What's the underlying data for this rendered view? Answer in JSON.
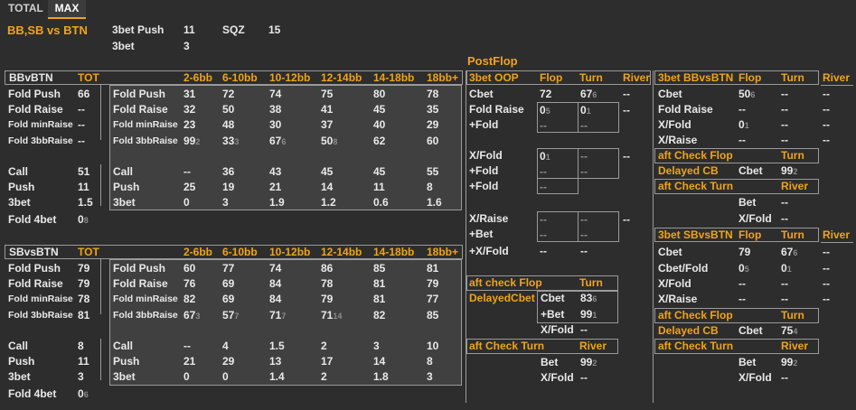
{
  "tabs": {
    "total": "TOTAL",
    "max": "MAX"
  },
  "header": {
    "title": "BB,SB vs BTN",
    "bet3push_label": "3bet Push",
    "bet3push_value": "11",
    "sqz_label": "SQZ",
    "sqz_value": "15",
    "bet3_label": "3bet",
    "bet3_value": "3"
  },
  "postflop_title": "PostFlop",
  "bb": {
    "title": "BBvBTN",
    "tot": "TOT",
    "cols": [
      "2-6bb",
      "6-10bb",
      "10-12bb",
      "12-14bb",
      "14-18bb",
      "18bb+"
    ],
    "rows": [
      {
        "label": "Fold Push",
        "tot": "66",
        "vals": [
          "31",
          "72",
          "74",
          "75",
          "80",
          "78"
        ],
        "sup": [
          "",
          "",
          "",
          "",
          "",
          ""
        ]
      },
      {
        "label": "Fold Raise",
        "tot": "--",
        "vals": [
          "32",
          "50",
          "38",
          "41",
          "45",
          "35"
        ],
        "sup": [
          "",
          "",
          "",
          "",
          "",
          ""
        ]
      },
      {
        "label": "Fold minRaise",
        "tot": "--",
        "vals": [
          "23",
          "48",
          "30",
          "37",
          "40",
          "29"
        ],
        "sup": [
          "",
          "",
          "",
          "",
          "",
          ""
        ]
      },
      {
        "label": "Fold 3bbRaise",
        "tot": "--",
        "vals": [
          "99",
          "33",
          "67",
          "50",
          "62",
          "60"
        ],
        "sup": [
          "2",
          "3",
          "6",
          "8",
          "",
          ""
        ]
      },
      {
        "label": "Call",
        "tot": "51",
        "vals": [
          "--",
          "36",
          "43",
          "45",
          "45",
          "55"
        ],
        "sup": [
          "",
          "",
          "",
          "",
          "",
          ""
        ]
      },
      {
        "label": "Push",
        "tot": "11",
        "vals": [
          "25",
          "19",
          "21",
          "14",
          "11",
          "8"
        ],
        "sup": [
          "",
          "",
          "",
          "",
          "",
          ""
        ]
      },
      {
        "label": "3bet",
        "tot": "1.5",
        "vals": [
          "0",
          "3",
          "1.9",
          "1.2",
          "0.6",
          "1.6"
        ],
        "sup": [
          "",
          "",
          "",
          "",
          "",
          ""
        ]
      }
    ],
    "fold4bet_label": "Fold 4bet",
    "fold4bet_value": "0",
    "fold4bet_sup": "8"
  },
  "sb": {
    "title": "SBvsBTN",
    "tot": "TOT",
    "cols": [
      "2-6bb",
      "6-10bb",
      "10-12bb",
      "12-14bb",
      "14-18bb",
      "18bb+"
    ],
    "rows": [
      {
        "label": "Fold Push",
        "tot": "79",
        "vals": [
          "60",
          "77",
          "74",
          "86",
          "85",
          "81"
        ],
        "sup": [
          "",
          "",
          "",
          "",
          "",
          ""
        ]
      },
      {
        "label": "Fold Raise",
        "tot": "79",
        "vals": [
          "76",
          "69",
          "84",
          "78",
          "81",
          "79"
        ],
        "sup": [
          "",
          "",
          "",
          "",
          "",
          ""
        ]
      },
      {
        "label": "Fold minRaise",
        "tot": "78",
        "vals": [
          "82",
          "69",
          "84",
          "79",
          "81",
          "77"
        ],
        "sup": [
          "",
          "",
          "",
          "",
          "",
          ""
        ]
      },
      {
        "label": "Fold 3bbRaise",
        "tot": "81",
        "vals": [
          "67",
          "57",
          "71",
          "71",
          "82",
          "85"
        ],
        "sup": [
          "3",
          "7",
          "7",
          "14",
          "",
          ""
        ]
      },
      {
        "label": "Call",
        "tot": "8",
        "vals": [
          "--",
          "4",
          "1.5",
          "2",
          "3",
          "10"
        ],
        "sup": [
          "",
          "",
          "",
          "",
          "",
          ""
        ]
      },
      {
        "label": "Push",
        "tot": "11",
        "vals": [
          "21",
          "29",
          "13",
          "17",
          "14",
          "8"
        ],
        "sup": [
          "",
          "",
          "",
          "",
          "",
          ""
        ]
      },
      {
        "label": "3bet",
        "tot": "3",
        "vals": [
          "0",
          "0",
          "1.4",
          "2",
          "1.8",
          "3"
        ],
        "sup": [
          "",
          "",
          "",
          "",
          "",
          ""
        ]
      }
    ],
    "fold4bet_label": "Fold 4bet",
    "fold4bet_value": "0",
    "fold4bet_sup": "6"
  },
  "oop": {
    "title": "3bet OOP",
    "flop": "Flop",
    "turn": "Turn",
    "river": "River",
    "cbet_label": "Cbet",
    "cbet_flop": "72",
    "cbet_turn": "67",
    "cbet_turn_sup": "6",
    "cbet_river": "--",
    "foldraise_label": "Fold Raise",
    "fr_flop": "0",
    "fr_flop_sup": "5",
    "fr_turn": "0",
    "fr_turn_sup": "1",
    "fr_river": "--",
    "plusfold_label": "+Fold",
    "pf_flop": "--",
    "pf_turn": "--",
    "xfold_label": "X/Fold",
    "xf_flop": "0",
    "xf_flop_sup": "1",
    "xf_turn": "--",
    "xf_river": "--",
    "xf_fold_label": "+Fold",
    "xf_fold_flop": "--",
    "xf_fold_turn": "--",
    "xf_fold2_label": "+Fold",
    "xf_fold2_flop": "--",
    "xraise_label": "X/Raise",
    "xr_flop": "--",
    "xr_turn": "--",
    "xr_river": "--",
    "xr_bet_label": "+Bet",
    "xr_bet_flop": "--",
    "xr_bet_turn": "--",
    "xr_xfold_label": "+X/Fold",
    "xr_xfold_flop": "--",
    "xr_xfold_turn": "--"
  },
  "aft_flop": {
    "title": "aft check Flop",
    "turn": "Turn",
    "delayed_label": "DelayedCbet",
    "cbet_label": "Cbet",
    "cbet_value": "83",
    "cbet_sup": "6",
    "bet_label": "+Bet",
    "bet_value": "99",
    "bet_sup": "1",
    "xfold_label": "X/Fold",
    "xfold_value": "--"
  },
  "aft_turn": {
    "title": "aft Check Turn",
    "river": "River",
    "bet_label": "Bet",
    "bet_value": "99",
    "bet_sup": "2",
    "xfold_label": "X/Fold",
    "xfold_value": "--"
  },
  "bb3": {
    "title": "3bet BBvsBTN",
    "flop": "Flop",
    "turn": "Turn",
    "river": "River",
    "cbet_label": "Cbet",
    "cbet_flop": "50",
    "cbet_flop_sup": "6",
    "cbet_turn": "--",
    "cbet_river": "--",
    "foldraise_label": "Fold Raise",
    "fr_flop": "--",
    "fr_turn": "--",
    "fr_river": "--",
    "xfold_label": "X/Fold",
    "xf_flop": "0",
    "xf_flop_sup": "1",
    "xf_turn": "--",
    "xf_river": "--",
    "xraise_label": "X/Raise",
    "xr_flop": "--",
    "xr_turn": "--",
    "xr_river": "--",
    "aft_flop_title": "aft Check Flop",
    "aft_flop_turn": "Turn",
    "delayed_label": "Delayed CB",
    "delayed_cbet_label": "Cbet",
    "delayed_cbet_value": "99",
    "delayed_cbet_sup": "2",
    "aft_turn_title": "aft Check Turn",
    "aft_turn_river": "River",
    "bet_label": "Bet",
    "bet_value": "--",
    "xfold2_label": "X/Fold",
    "xfold2_value": "--"
  },
  "sb3": {
    "title": "3bet SBvsBTN",
    "flop": "Flop",
    "turn": "Turn",
    "river": "River",
    "cbet_label": "Cbet",
    "cbet_flop": "79",
    "cbet_turn": "67",
    "cbet_turn_sup": "6",
    "cbet_river": "--",
    "cbetfold_label": "Cbet/Fold",
    "cf_flop": "0",
    "cf_flop_sup": "5",
    "cf_turn": "0",
    "cf_turn_sup": "1",
    "cf_river": "--",
    "xfold_label": "X/Fold",
    "xf_flop": "--",
    "xf_turn": "--",
    "xf_river": "--",
    "xraise_label": "X/Raise",
    "xr_flop": "--",
    "xr_turn": "--",
    "xr_river": "--",
    "aft_flop_title": "aft Check Flop",
    "aft_flop_turn": "Turn",
    "delayed_label": "Delayed CB",
    "delayed_cbet_label": "Cbet",
    "delayed_cbet_value": "75",
    "delayed_cbet_sup": "4",
    "aft_turn_title": "aft Check Turn",
    "aft_turn_river": "River",
    "bet_label": "Bet",
    "bet_value": "99",
    "bet_sup": "2",
    "xfold2_label": "X/Fold",
    "xfold2_value": "--"
  }
}
